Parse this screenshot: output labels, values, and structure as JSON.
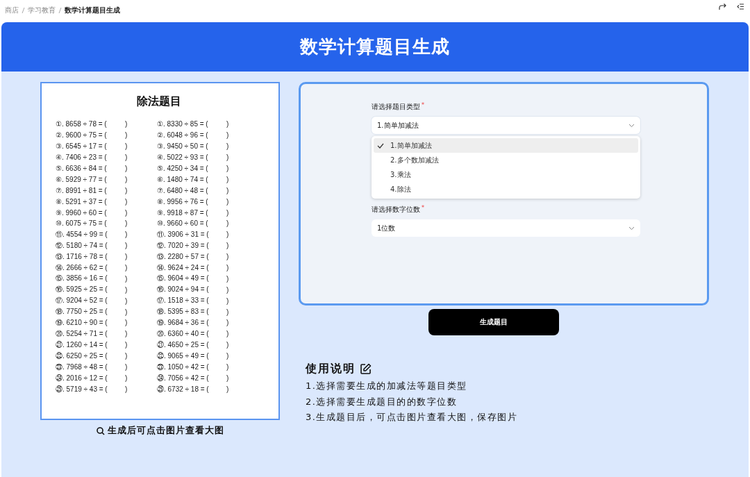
{
  "breadcrumb": [
    {
      "label": "商店",
      "current": false
    },
    {
      "label": "学习教育",
      "current": false
    },
    {
      "label": "数学计算题目生成",
      "current": true
    }
  ],
  "header": {
    "title": "数学计算题目生成"
  },
  "worksheet": {
    "title": "除法题目",
    "columns": [
      [
        {
          "q": "①. 8658 ÷ 78 = (",
          "a": ")"
        },
        {
          "q": "②. 9600 ÷ 75 = (",
          "a": ")"
        },
        {
          "q": "③. 6545 ÷ 17 = (",
          "a": ")"
        },
        {
          "q": "④. 7406 ÷ 23 = (",
          "a": ")"
        },
        {
          "q": "⑤. 6636 ÷ 84 = (",
          "a": ")"
        },
        {
          "q": "⑥. 5929 ÷ 77 = (",
          "a": ")"
        },
        {
          "q": "⑦. 8991 ÷ 81 = (",
          "a": ")"
        },
        {
          "q": "⑧. 5291 ÷ 37 = (",
          "a": ")"
        },
        {
          "q": "⑨. 9960 ÷ 60 = (",
          "a": ")"
        },
        {
          "q": "⑩. 6075 ÷ 75 = (",
          "a": ")"
        },
        {
          "q": "⑪. 4554 ÷ 99 = (",
          "a": ")"
        },
        {
          "q": "⑫. 5180 ÷ 74 = (",
          "a": ")"
        },
        {
          "q": "⑬. 1716 ÷ 78 = (",
          "a": ")"
        },
        {
          "q": "⑭. 2666 ÷ 62 = (",
          "a": ")"
        },
        {
          "q": "⑮. 3856 ÷ 16 = (",
          "a": ")"
        },
        {
          "q": "⑯. 5925 ÷ 25 = (",
          "a": ")"
        },
        {
          "q": "⑰. 9204 ÷ 52 = (",
          "a": ")"
        },
        {
          "q": "⑱. 7750 ÷ 25 = (",
          "a": ")"
        },
        {
          "q": "⑲. 6210 ÷ 90 = (",
          "a": ")"
        },
        {
          "q": "⑳. 5254 ÷ 71 = (",
          "a": ")"
        },
        {
          "q": "㉑. 1260 ÷ 14 = (",
          "a": ")"
        },
        {
          "q": "㉒. 6250 ÷ 25 = (",
          "a": ")"
        },
        {
          "q": "㉓. 7968 ÷ 48 = (",
          "a": ")"
        },
        {
          "q": "㉔. 2016 ÷ 12 = (",
          "a": ")"
        },
        {
          "q": "㉕. 5719 ÷ 43 = (",
          "a": ")"
        }
      ],
      [
        {
          "q": "①. 8330 ÷ 85 = (",
          "a": ")"
        },
        {
          "q": "②. 6048 ÷ 96 = (",
          "a": ")"
        },
        {
          "q": "③. 9450 ÷ 50 = (",
          "a": ")"
        },
        {
          "q": "④. 5022 ÷ 93 = (",
          "a": ")"
        },
        {
          "q": "⑤. 4250 ÷ 34 = (",
          "a": ")"
        },
        {
          "q": "⑥. 1480 ÷ 74 = (",
          "a": ")"
        },
        {
          "q": "⑦. 6480 ÷ 48 = (",
          "a": ")"
        },
        {
          "q": "⑧. 9956 ÷ 76 = (",
          "a": ")"
        },
        {
          "q": "⑨. 9918 ÷ 87 = (",
          "a": ")"
        },
        {
          "q": "⑩. 9660 ÷ 60 = (",
          "a": ")"
        },
        {
          "q": "⑪. 3906 ÷ 31 = (",
          "a": ")"
        },
        {
          "q": "⑫. 7020 ÷ 39 = (",
          "a": ")"
        },
        {
          "q": "⑬. 2280 ÷ 57 = (",
          "a": ")"
        },
        {
          "q": "⑭. 9624 ÷ 24 = (",
          "a": ")"
        },
        {
          "q": "⑮. 9604 ÷ 49 = (",
          "a": ")"
        },
        {
          "q": "⑯. 9024 ÷ 94 = (",
          "a": ")"
        },
        {
          "q": "⑰. 1518 ÷ 33 = (",
          "a": ")"
        },
        {
          "q": "⑱. 5395 ÷ 83 = (",
          "a": ")"
        },
        {
          "q": "⑲. 9684 ÷ 36 = (",
          "a": ")"
        },
        {
          "q": "⑳. 6360 ÷ 40 = (",
          "a": ")"
        },
        {
          "q": "㉑. 4650 ÷ 25 = (",
          "a": ")"
        },
        {
          "q": "㉒. 9065 ÷ 49 = (",
          "a": ")"
        },
        {
          "q": "㉓. 1050 ÷ 42 = (",
          "a": ")"
        },
        {
          "q": "㉔. 7056 ÷ 42 = (",
          "a": ")"
        },
        {
          "q": "㉕. 6732 ÷ 18 = (",
          "a": ")"
        }
      ]
    ]
  },
  "caption": "生成后可点击图片查看大图",
  "form": {
    "type_field": {
      "label": "请选择题目类型",
      "required_mark": "*",
      "value": "1.简单加减法",
      "expanded": true,
      "options": [
        {
          "label": "1.简单加减法",
          "selected": true
        },
        {
          "label": "2.多个数加减法",
          "selected": false
        },
        {
          "label": "3.乘法",
          "selected": false
        },
        {
          "label": "4.除法",
          "selected": false
        }
      ]
    },
    "digits_field": {
      "label": "请选择数字位数",
      "required_mark": "*",
      "value": "1位数"
    }
  },
  "generate_button": "生成题目",
  "instructions": {
    "title": "使用说明",
    "steps": [
      "1.选择需要生成的加减法等题目类型",
      "2.选择需要生成题目的的数字位数",
      "3.生成题目后，可点击图片查看大图，保存图片"
    ]
  }
}
